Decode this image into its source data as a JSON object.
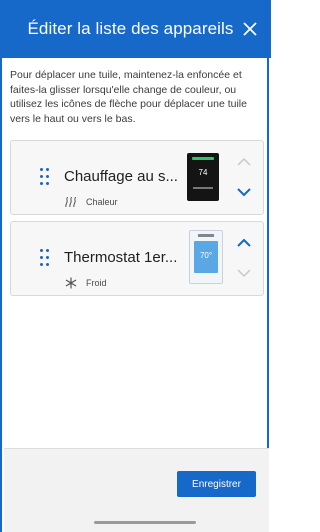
{
  "header": {
    "title": "Éditer la liste des appareils",
    "close_icon": "close-icon"
  },
  "instructions": "Pour déplacer une tuile, maintenez-la enfoncée et faites-la glisser lorsqu'elle change de couleur, ou utilisez les icônes de flèche pour déplacer une tuile vers le haut ou vers le bas.",
  "devices": [
    {
      "name": "Chauffage au s...",
      "mode_label": "Chaleur",
      "mode_icon": "heat-icon",
      "thumbnail_value": "74",
      "up_enabled": false,
      "down_enabled": true
    },
    {
      "name": "Thermostat 1er...",
      "mode_label": "Froid",
      "mode_icon": "snowflake-icon",
      "thumbnail_value": "70°",
      "up_enabled": true,
      "down_enabled": false
    }
  ],
  "footer": {
    "save_label": "Enregistrer"
  },
  "colors": {
    "primary": "#1668c9",
    "disabled_arrow": "#c8c8c8",
    "card_bg": "#f7f7f7"
  }
}
